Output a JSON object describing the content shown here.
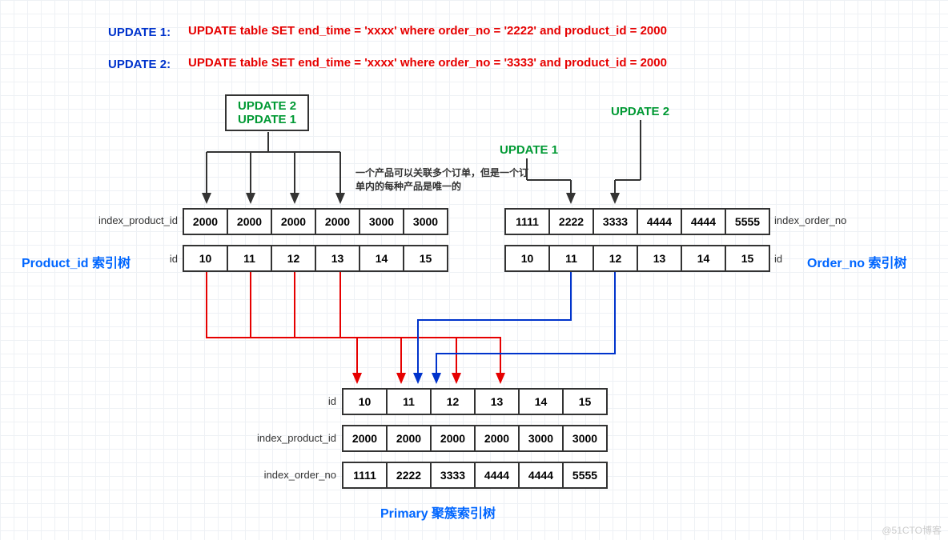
{
  "updates": {
    "label1": "UPDATE 1:",
    "sql1": "UPDATE table SET end_time = 'xxxx' where order_no = '2222' and product_id = 2000",
    "label2": "UPDATE 2:",
    "sql2": "UPDATE table SET end_time = 'xxxx' where order_no = '3333' and product_id = 2000"
  },
  "top_box": {
    "line1": "UPDATE 2",
    "line2": "UPDATE 1"
  },
  "right_labels": {
    "update2": "UPDATE 2",
    "update1": "UPDATE 1"
  },
  "note": "一个产品可以关联多个订单，但是一个订单内的每种产品是唯一的",
  "left_index": {
    "title": "Product_id 索引树",
    "row1_label": "index_product_id",
    "row2_label": "id",
    "product_ids": [
      "2000",
      "2000",
      "2000",
      "2000",
      "3000",
      "3000"
    ],
    "ids": [
      "10",
      "11",
      "12",
      "13",
      "14",
      "15"
    ]
  },
  "right_index": {
    "title": "Order_no 索引树",
    "row1_label": "index_order_no",
    "order_nos": [
      "1111",
      "2222",
      "3333",
      "4444",
      "4444",
      "5555"
    ],
    "row2_label": "id",
    "ids": [
      "10",
      "11",
      "12",
      "13",
      "14",
      "15"
    ]
  },
  "primary": {
    "title": "Primary 聚簇索引树",
    "row1_label": "id",
    "ids": [
      "10",
      "11",
      "12",
      "13",
      "14",
      "15"
    ],
    "row2_label": "index_product_id",
    "product_ids": [
      "2000",
      "2000",
      "2000",
      "2000",
      "3000",
      "3000"
    ],
    "row3_label": "index_order_no",
    "order_nos": [
      "1111",
      "2222",
      "3333",
      "4444",
      "4444",
      "5555"
    ]
  },
  "watermark": "@51CTO博客"
}
